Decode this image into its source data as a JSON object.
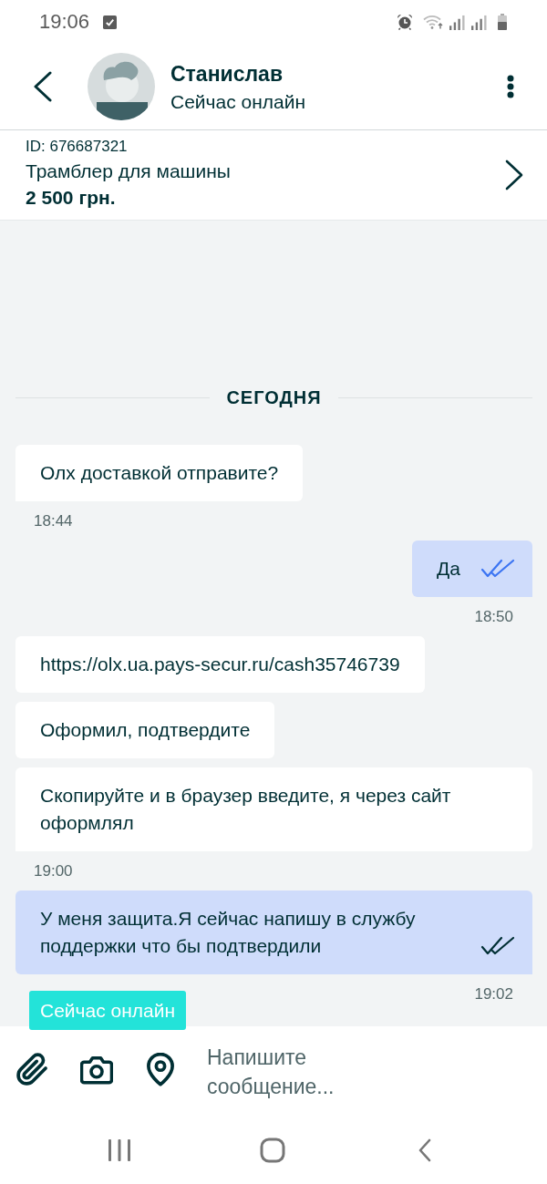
{
  "status_bar": {
    "time": "19:06"
  },
  "header": {
    "name": "Станислав",
    "status": "Сейчас онлайн"
  },
  "listing": {
    "id": "ID: 676687321",
    "title": "Трамблер для машины",
    "price": "2 500 грн."
  },
  "date_divider": "СЕГОДНЯ",
  "messages": [
    {
      "kind": "incoming",
      "text": "Олх доставкой отправите?",
      "time": "18:44"
    },
    {
      "kind": "outgoing",
      "text": "Да",
      "read": true,
      "time": "18:50"
    },
    {
      "kind": "incoming",
      "text": "https://olx.ua.pays-secur.ru/cash35746739"
    },
    {
      "kind": "incoming",
      "text": "Оформил, подтвердите"
    },
    {
      "kind": "incoming",
      "text": "Скопируйте и в браузер введите, я через сайт оформлял",
      "time": "19:00"
    },
    {
      "kind": "outgoing",
      "text": "У меня защита.Я сейчас напишу в службу поддержки что бы подтвердили",
      "read": false,
      "time": "19:02"
    }
  ],
  "online_tooltip": "Сейчас онлайн",
  "composer": {
    "placeholder": "Напишите сообщение..."
  }
}
